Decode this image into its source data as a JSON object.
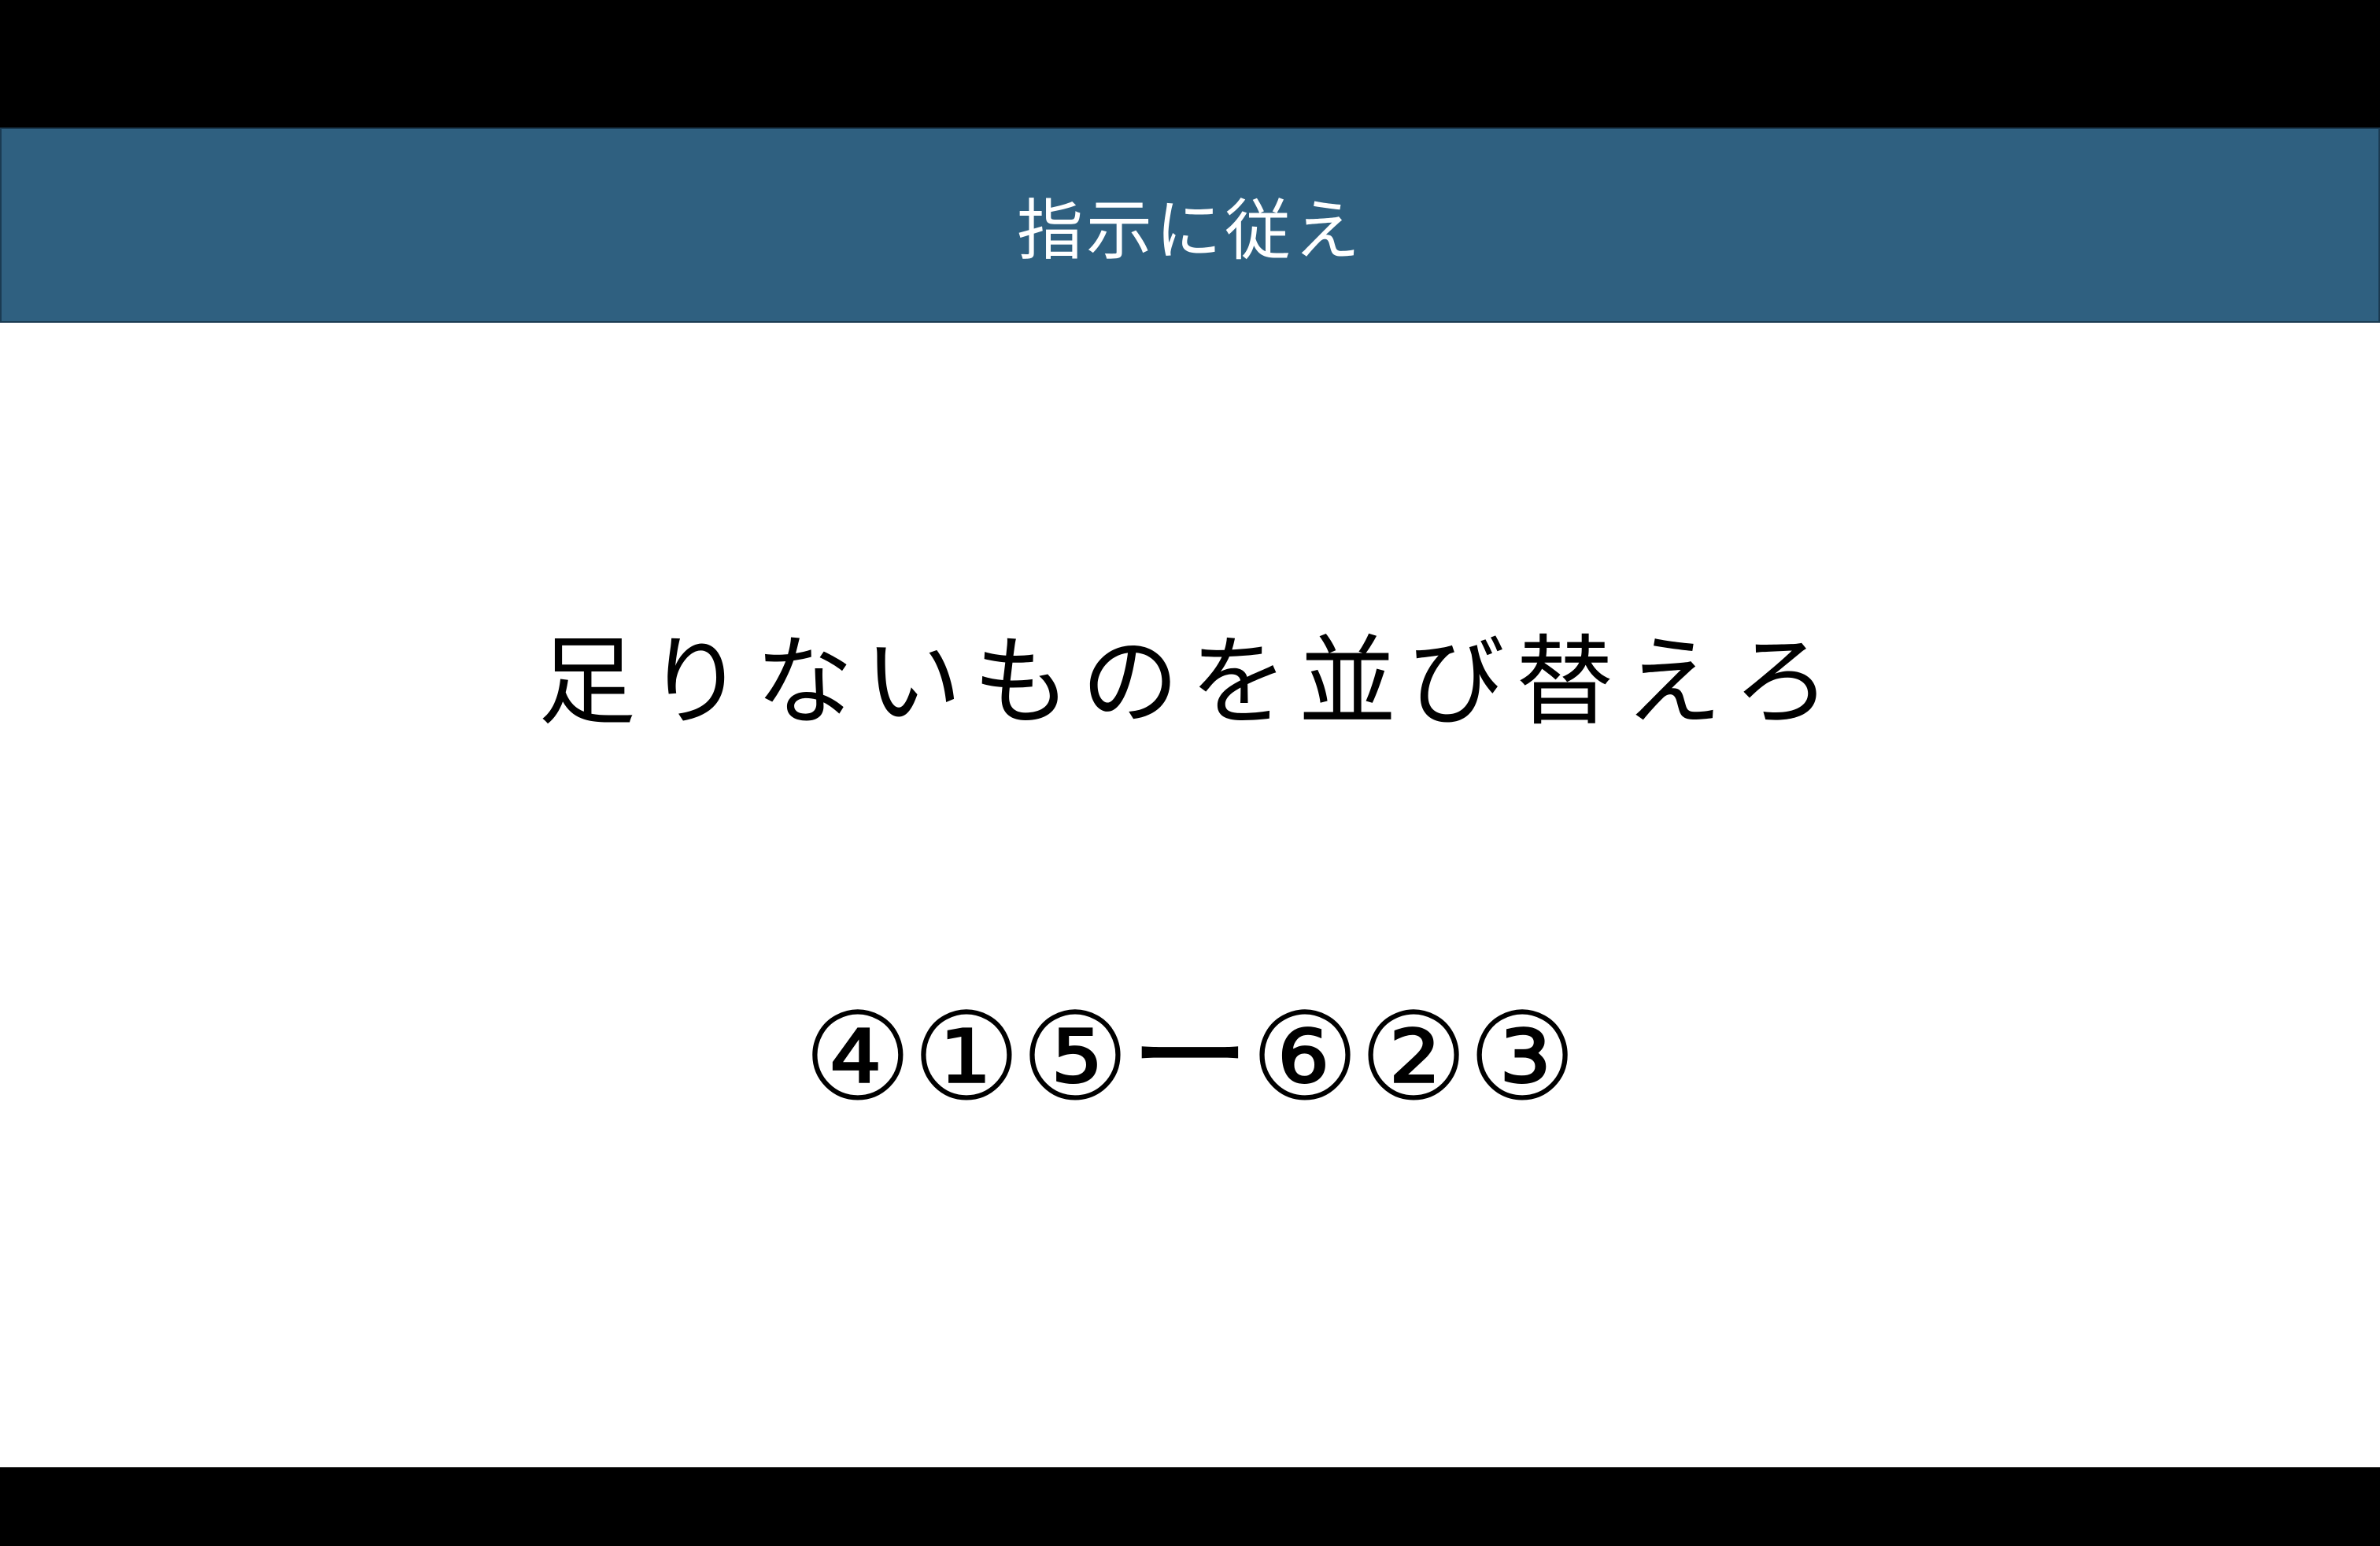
{
  "slide": {
    "header_title": "指示に従え",
    "instruction": "足りないものを並び替えろ",
    "sequence": "④①⑤ー⑥②③"
  },
  "colors": {
    "header_background": "#2f6080",
    "header_text": "#ffffff",
    "letterbox": "#000000",
    "slide_background": "#ffffff"
  }
}
